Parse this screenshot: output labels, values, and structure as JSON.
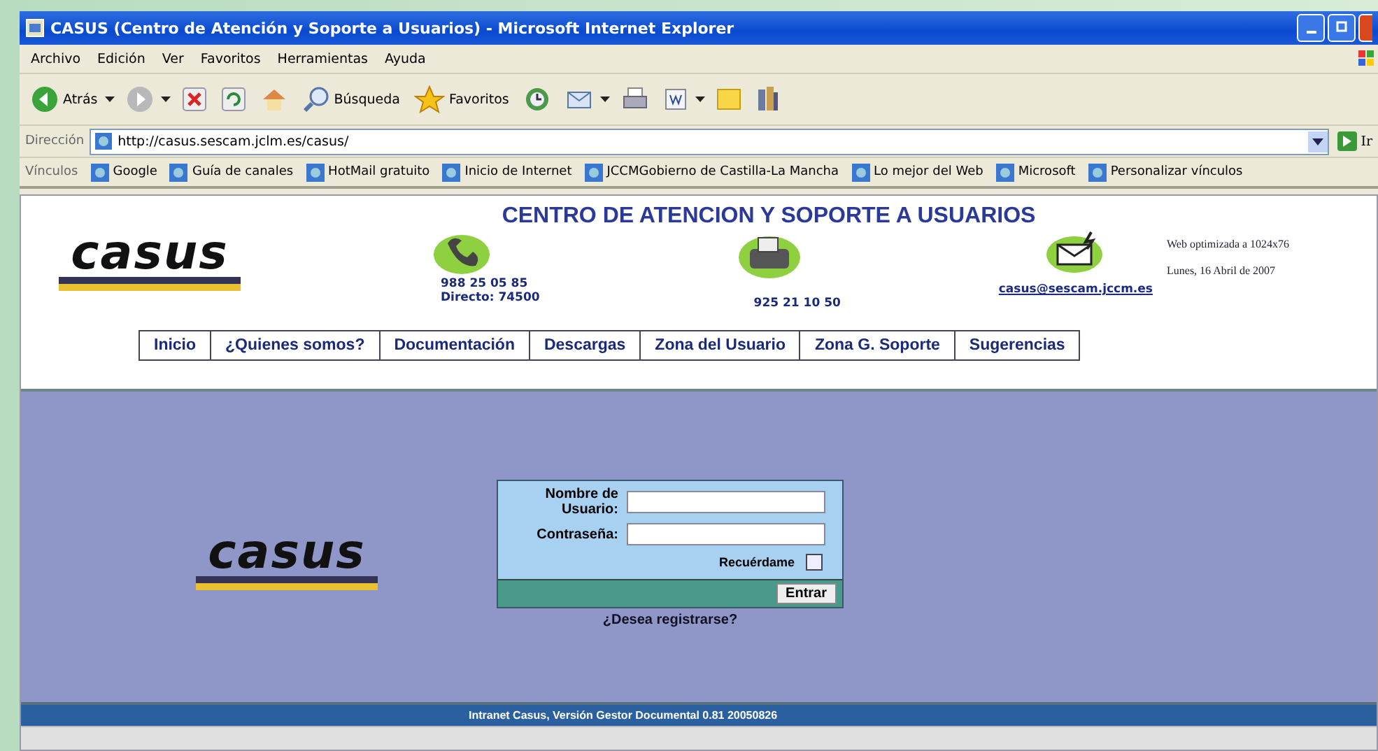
{
  "window": {
    "title": "CASUS (Centro de Atención y Soporte a Usuarios) - Microsoft Internet Explorer"
  },
  "menu": [
    "Archivo",
    "Edición",
    "Ver",
    "Favoritos",
    "Herramientas",
    "Ayuda"
  ],
  "toolbar": [
    {
      "kind": "back",
      "label": "Atrás",
      "menu": true
    },
    {
      "kind": "forward",
      "menu": true
    },
    {
      "kind": "stop",
      "menu": false
    },
    {
      "kind": "refresh",
      "menu": false
    },
    {
      "kind": "home",
      "menu": false
    },
    {
      "kind": "search",
      "label": "Búsqueda",
      "menu": false
    },
    {
      "kind": "favorites",
      "label": "Favoritos",
      "menu": false
    },
    {
      "kind": "history",
      "menu": false
    },
    {
      "kind": "mail",
      "menu": true
    },
    {
      "kind": "print",
      "menu": false
    },
    {
      "kind": "edit",
      "menu": true
    },
    {
      "kind": "notes",
      "menu": false
    },
    {
      "kind": "research",
      "menu": false
    }
  ],
  "address": {
    "label": "Dirección",
    "url": "http://casus.sescam.jclm.es/casus/",
    "go": "Ir"
  },
  "links": {
    "label": "Vínculos",
    "items": [
      "Google",
      "Guía de canales",
      "HotMail gratuito",
      "Inicio de Internet",
      "JCCMGobierno de Castilla-La Mancha",
      "Lo mejor del Web",
      "Microsoft",
      "Personalizar vínculos"
    ]
  },
  "page": {
    "logo": "casus",
    "heading": "CENTRO DE ATENCION Y SOPORTE A USUARIOS",
    "phone": [
      "988 25 05 85",
      "Directo: 74500"
    ],
    "fax": "925 21 10 50",
    "email": "casus@sescam.jccm.es",
    "info": [
      "Web optimizada a 1024x76",
      "Lunes, 16 Abril de 2007"
    ],
    "nav": [
      "Inicio",
      "¿Quienes somos?",
      "Documentación",
      "Descargas",
      "Zona del Usuario",
      "Zona G. Soporte",
      "Sugerencias"
    ]
  },
  "login": {
    "logo": "casus",
    "user_label": "Nombre de Usuario:",
    "password_label": "Contraseña:",
    "remember": {
      "label": "Recuérdame",
      "checked": false
    },
    "button": "Entrar",
    "register": "¿Desea registrarse?"
  },
  "footer": "Intranet Casus, Versión Gestor Documental 0.81 20050826"
}
